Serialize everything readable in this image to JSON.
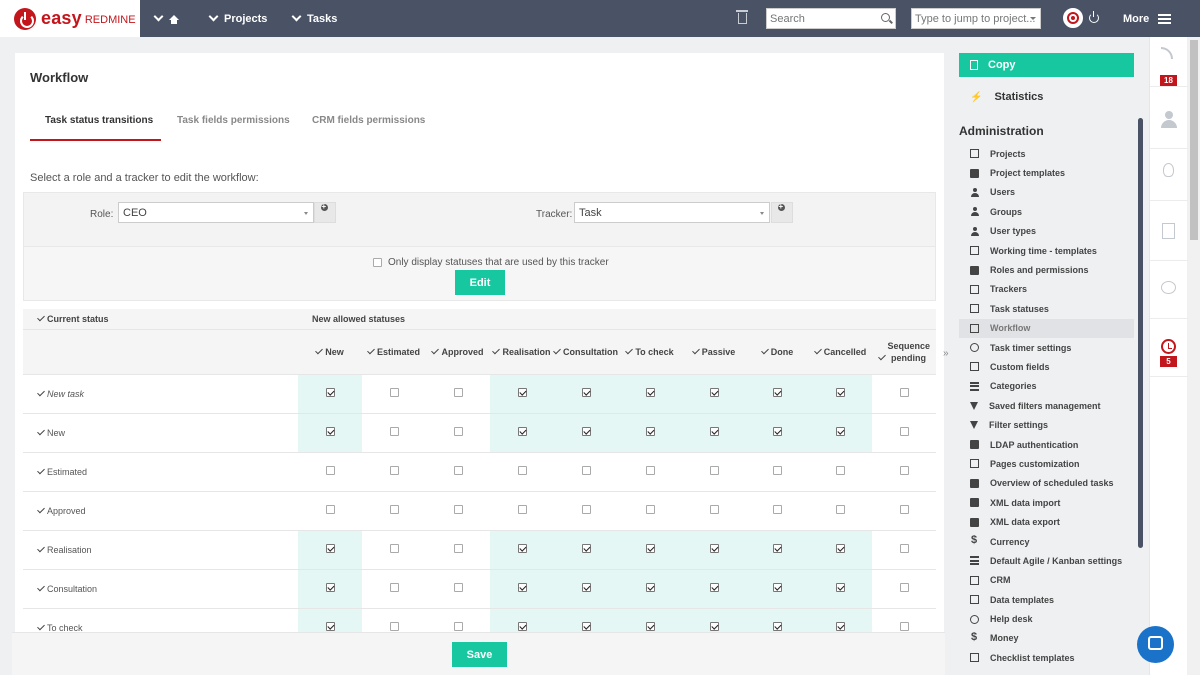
{
  "brand": {
    "easy": "easy",
    "redmine": "REDMINE"
  },
  "topnav": {
    "projects": "Projects",
    "tasks": "Tasks",
    "search_placeholder": "Search",
    "jump_placeholder": "Type to jump to project...",
    "more": "More"
  },
  "page": {
    "title": "Workflow",
    "tabs": [
      "Task status transitions",
      "Task fields permissions",
      "CRM fields permissions"
    ],
    "intro": "Select a role and a tracker to edit the workflow:",
    "role_label": "Role:",
    "role_value": "CEO",
    "tracker_label": "Tracker:",
    "tracker_value": "Task",
    "only_used_label": "Only display statuses that are used by this tracker",
    "edit_label": "Edit",
    "save_label": "Save",
    "sidebar_toggle": "»"
  },
  "table": {
    "current_status_header": "Current status",
    "new_allowed_header": "New allowed statuses",
    "columns": [
      "New",
      "Estimated",
      "Approved",
      "Realisation",
      "Consultation",
      "To check",
      "Passive",
      "Done",
      "Cancelled",
      "Sequence pending"
    ],
    "highlight_columns": [
      0,
      3,
      4,
      5,
      6,
      7,
      8
    ],
    "rows": [
      {
        "label": "New task",
        "italic": true,
        "checks": [
          1,
          0,
          0,
          1,
          1,
          1,
          1,
          1,
          1,
          0
        ]
      },
      {
        "label": "New",
        "italic": false,
        "checks": [
          1,
          0,
          0,
          1,
          1,
          1,
          1,
          1,
          1,
          0
        ]
      },
      {
        "label": "Estimated",
        "italic": false,
        "checks": [
          0,
          0,
          0,
          0,
          0,
          0,
          0,
          0,
          0,
          0
        ]
      },
      {
        "label": "Approved",
        "italic": false,
        "checks": [
          0,
          0,
          0,
          0,
          0,
          0,
          0,
          0,
          0,
          0
        ]
      },
      {
        "label": "Realisation",
        "italic": false,
        "checks": [
          1,
          0,
          0,
          1,
          1,
          1,
          1,
          1,
          1,
          0
        ]
      },
      {
        "label": "Consultation",
        "italic": false,
        "checks": [
          1,
          0,
          0,
          1,
          1,
          1,
          1,
          1,
          1,
          0
        ]
      },
      {
        "label": "To check",
        "italic": false,
        "checks": [
          1,
          0,
          0,
          1,
          1,
          1,
          1,
          1,
          1,
          0
        ]
      }
    ]
  },
  "sidebar": {
    "copy": "Copy",
    "statistics": "Statistics",
    "admin_heading": "Administration",
    "items": [
      {
        "label": "Projects",
        "icon": "folder-icon"
      },
      {
        "label": "Project templates",
        "icon": "folder-solid-icon"
      },
      {
        "label": "Users",
        "icon": "user-icon"
      },
      {
        "label": "Groups",
        "icon": "group-icon"
      },
      {
        "label": "User types",
        "icon": "user-types-icon"
      },
      {
        "label": "Working time - templates",
        "icon": "calendar-icon"
      },
      {
        "label": "Roles and permissions",
        "icon": "wrench-icon"
      },
      {
        "label": "Trackers",
        "icon": "clipboard-icon"
      },
      {
        "label": "Task statuses",
        "icon": "clipboard-check-icon"
      },
      {
        "label": "Workflow",
        "icon": "clipboard-icon",
        "active": true
      },
      {
        "label": "Task timer settings",
        "icon": "history-icon"
      },
      {
        "label": "Custom fields",
        "icon": "edit-icon"
      },
      {
        "label": "Categories",
        "icon": "categories-icon"
      },
      {
        "label": "Saved filters management",
        "icon": "funnel-icon"
      },
      {
        "label": "Filter settings",
        "icon": "funnel-icon"
      },
      {
        "label": "LDAP authentication",
        "icon": "server-icon"
      },
      {
        "label": "Pages customization",
        "icon": "page-icon"
      },
      {
        "label": "Overview of scheduled tasks",
        "icon": "brush-icon"
      },
      {
        "label": "XML data import",
        "icon": "download-icon"
      },
      {
        "label": "XML data export",
        "icon": "upload-icon"
      },
      {
        "label": "Currency",
        "icon": "dollar-icon"
      },
      {
        "label": "Default Agile / Kanban settings",
        "icon": "list-icon"
      },
      {
        "label": "CRM",
        "icon": "crm-icon"
      },
      {
        "label": "Data templates",
        "icon": "copy-icon"
      },
      {
        "label": "Help desk",
        "icon": "chat-icon"
      },
      {
        "label": "Money",
        "icon": "dollar-icon"
      },
      {
        "label": "Checklist templates",
        "icon": "checklist-icon"
      }
    ]
  },
  "rail": {
    "activity_badge": "18",
    "history_badge": "5"
  },
  "colors": {
    "topbar": "#4a5266",
    "accent": "#16c7a0",
    "brand_red": "#c3161c",
    "highlight": "#e4f7f4"
  }
}
